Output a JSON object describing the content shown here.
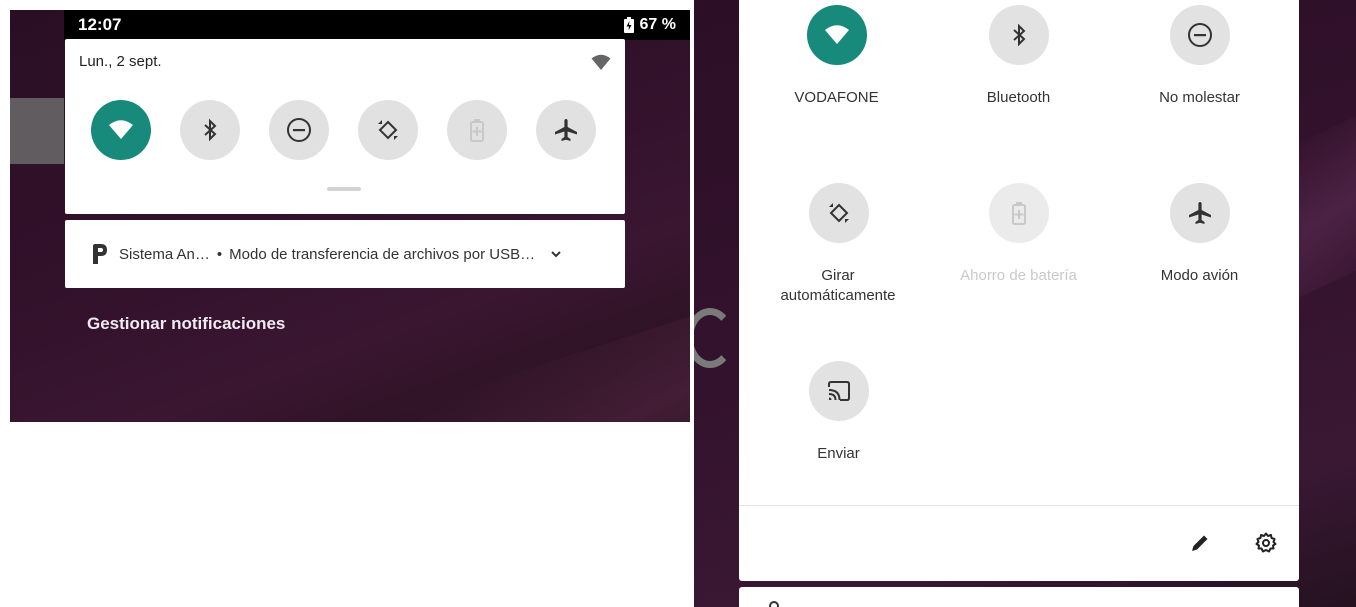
{
  "colors": {
    "accent": "#178a7b",
    "tile_inactive": "#e2e2e2",
    "wallpaper": "#32112b"
  },
  "left": {
    "status_bar": {
      "time": "12:07",
      "battery_icon": "battery-charging-icon",
      "battery_level": "67 %"
    },
    "quick_settings": {
      "date": "Lun., 2 sept.",
      "tiles": [
        {
          "icon": "wifi-icon",
          "active": true
        },
        {
          "icon": "bluetooth-icon",
          "active": false
        },
        {
          "icon": "do-not-disturb-icon",
          "active": false
        },
        {
          "icon": "auto-rotate-icon",
          "active": false
        },
        {
          "icon": "battery-saver-icon",
          "active": false,
          "disabled": true
        },
        {
          "icon": "airplane-icon",
          "active": false
        }
      ]
    },
    "notification": {
      "app_name": "Sistema An…",
      "separator": "•",
      "text": "Modo de transferencia de archivos por USB…"
    },
    "manage_notifications": "Gestionar notificaciones"
  },
  "right": {
    "tiles": [
      {
        "label": "VODAFONE",
        "icon": "wifi-icon",
        "active": true
      },
      {
        "label": "Bluetooth",
        "icon": "bluetooth-icon",
        "active": false
      },
      {
        "label": "No molestar",
        "icon": "do-not-disturb-icon",
        "active": false
      },
      {
        "label": "Girar automáticamente",
        "icon": "auto-rotate-icon",
        "active": false
      },
      {
        "label": "Ahorro de batería",
        "icon": "battery-saver-icon",
        "active": false,
        "disabled": true
      },
      {
        "label": "Modo avión",
        "icon": "airplane-icon",
        "active": false
      },
      {
        "label": "Enviar",
        "icon": "cast-icon",
        "active": false
      }
    ],
    "footer": {
      "edit_icon": "pencil-icon",
      "settings_icon": "gear-icon"
    }
  }
}
